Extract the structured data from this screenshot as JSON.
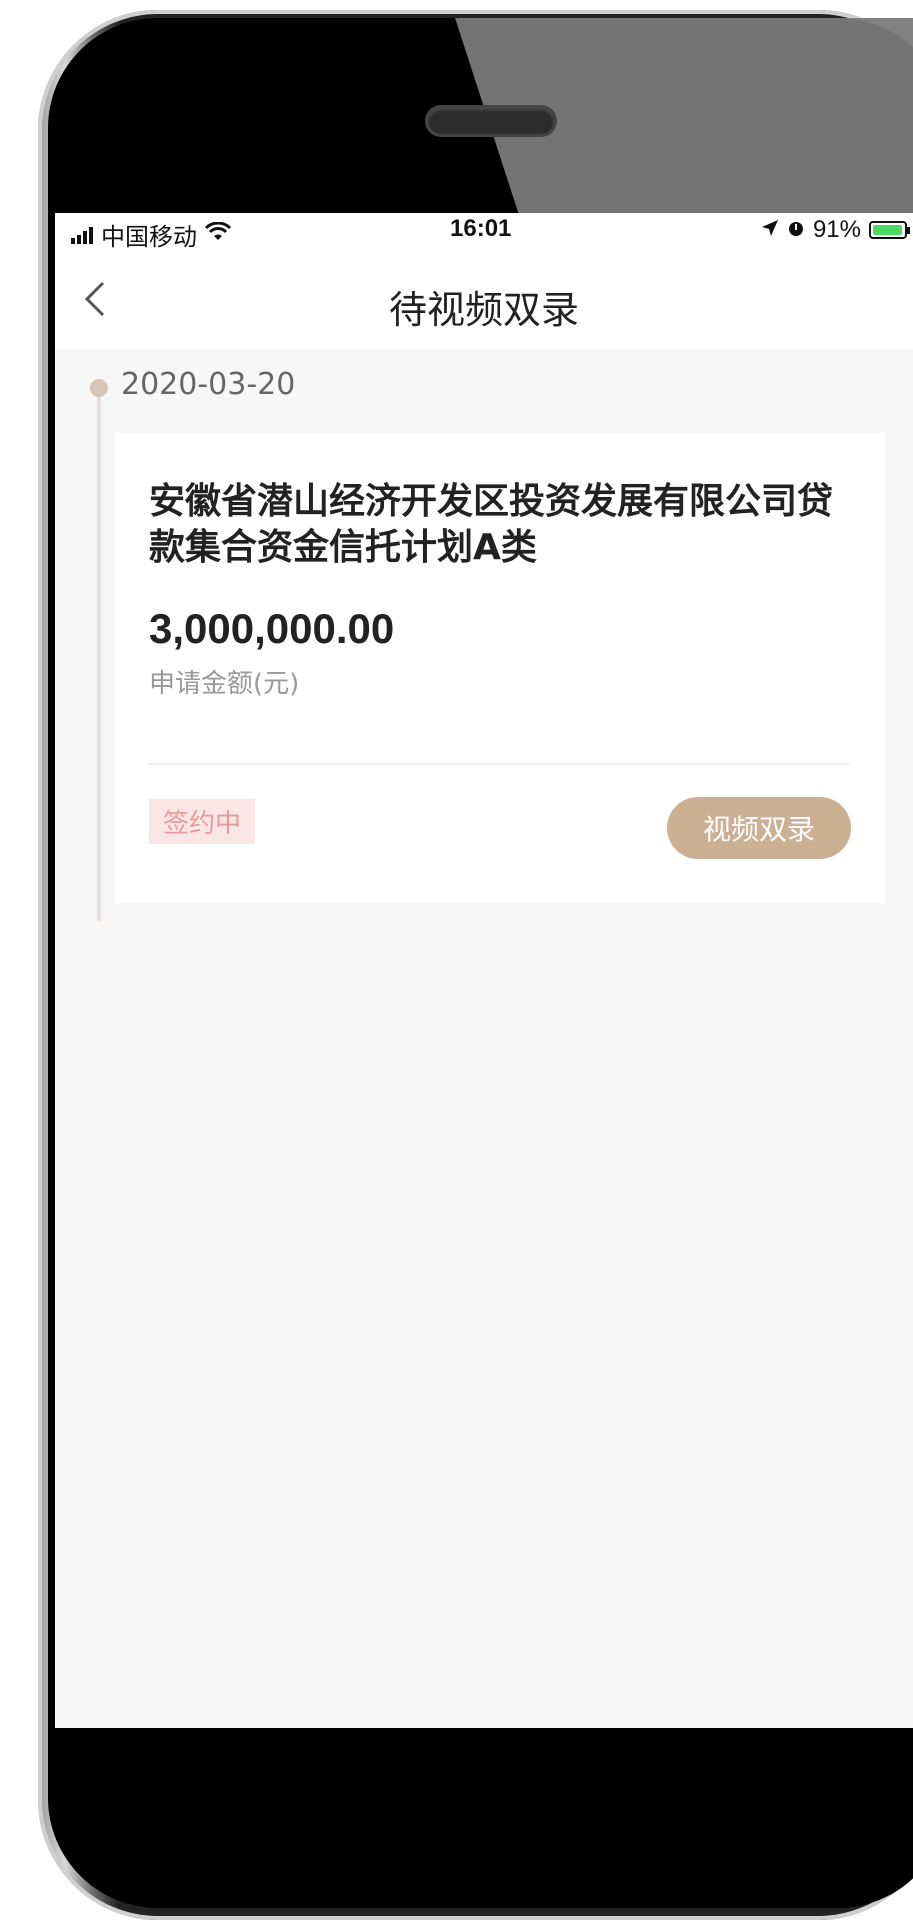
{
  "status_bar": {
    "carrier": "中国移动",
    "time": "16:01",
    "battery": "91%",
    "icons": [
      "signal-icon",
      "wifi-icon",
      "location-icon",
      "alarm-icon",
      "battery-icon"
    ]
  },
  "nav": {
    "title": "待视频双录",
    "back_icon": "chevron-left-icon"
  },
  "timeline": {
    "date": "2020-03-20"
  },
  "card": {
    "title": "安徽省潜山经济开发区投资发展有限公司贷款集合资金信托计划A类",
    "amount": "3,000,000.00",
    "amount_label": "申请金额(元)",
    "status": "签约中",
    "action_label": "视频双录"
  },
  "colors": {
    "accent": "#cbb094",
    "status_bg": "#fbe6e6",
    "status_text": "#e59b9b",
    "background": "#f7f7f7"
  }
}
